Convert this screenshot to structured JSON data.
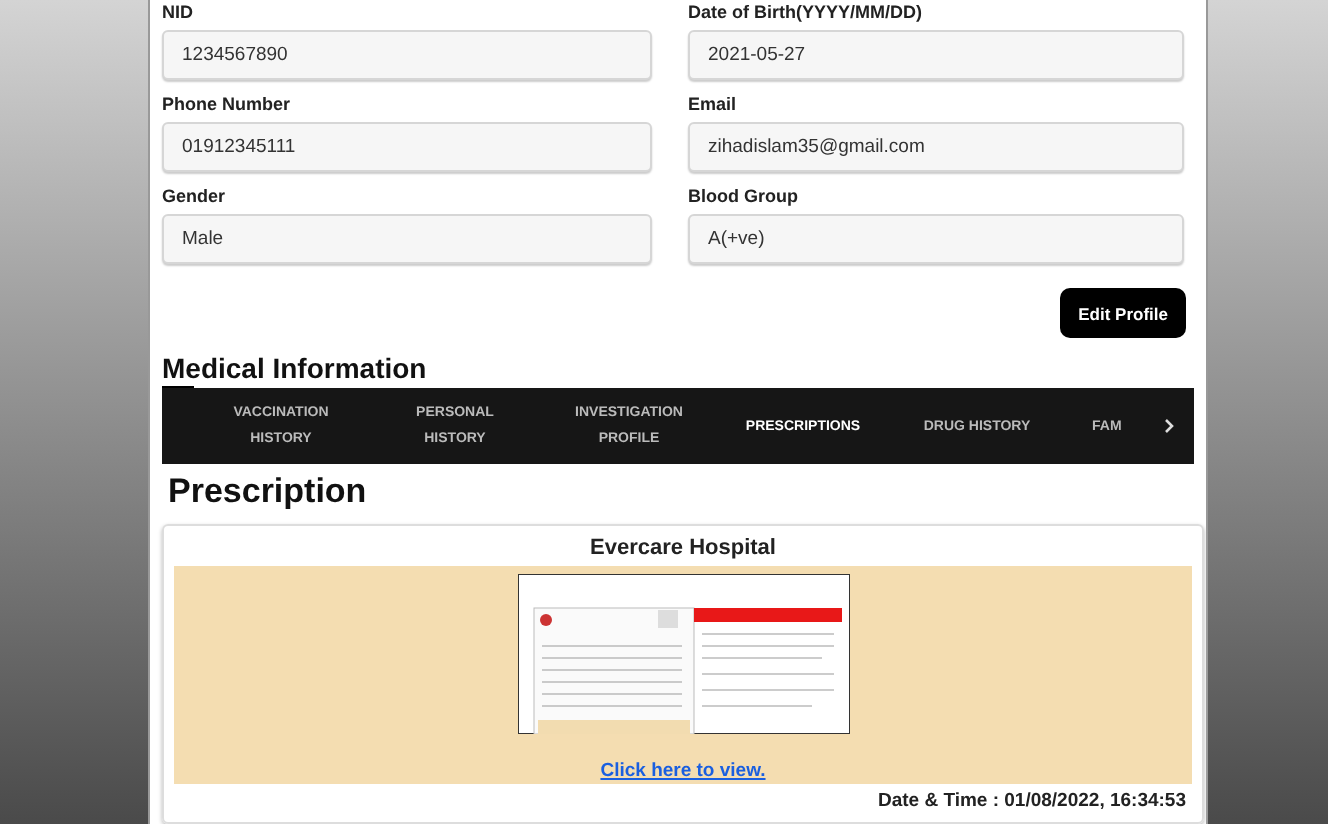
{
  "profile": {
    "fields": [
      {
        "label": "NID",
        "value": "1234567890"
      },
      {
        "label": "Date of Birth(YYYY/MM/DD)",
        "value": "2021-05-27"
      },
      {
        "label": "Phone Number",
        "value": "01912345111"
      },
      {
        "label": "Email",
        "value": "zihadislam35@gmail.com"
      },
      {
        "label": "Gender",
        "value": "Male"
      },
      {
        "label": "Blood Group",
        "value": "A(+ve)"
      }
    ],
    "edit_button": "Edit Profile"
  },
  "section_title": "Medical Information",
  "tabs": [
    {
      "label": "VACCINATION HISTORY",
      "selected": false
    },
    {
      "label": "PERSONAL HISTORY",
      "selected": false
    },
    {
      "label": "INVESTIGATION PROFILE",
      "selected": false
    },
    {
      "label": "PRESCRIPTIONS",
      "selected": true
    },
    {
      "label": "DRUG HISTORY",
      "selected": false
    },
    {
      "label": "FAM",
      "selected": false
    }
  ],
  "prescription": {
    "title": "Prescription",
    "hospital": "Evercare Hospital",
    "link": "Click here to view.",
    "datetime": "Date & Time : 01/08/2022, 16:34:53"
  }
}
